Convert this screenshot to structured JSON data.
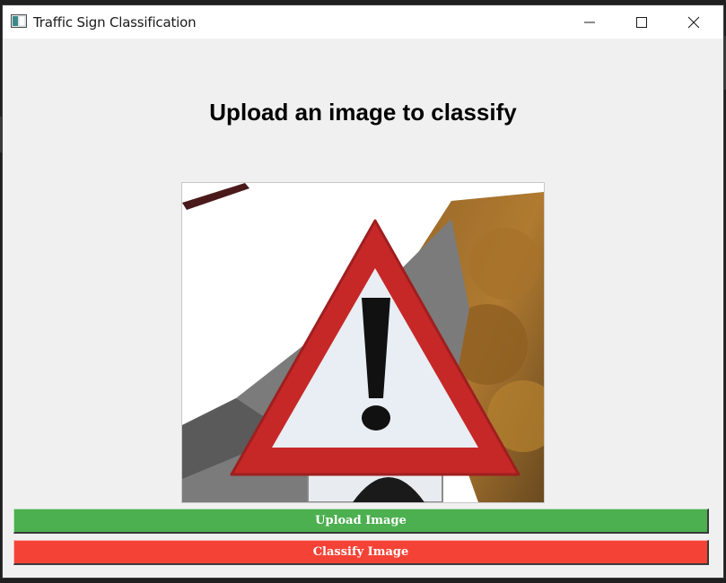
{
  "window": {
    "title": "Traffic Sign Classification"
  },
  "main": {
    "heading": "Upload an image to classify",
    "preview_image": "warning-triangle-exclamation-sign-photo"
  },
  "buttons": {
    "upload_label": "Upload Image",
    "classify_label": "Classify Image",
    "upload_color": "#4caf50",
    "classify_color": "#f44336"
  },
  "icons": {
    "app": "window-app-icon",
    "minimize": "minimize-icon",
    "maximize": "maximize-icon",
    "close": "close-icon"
  }
}
